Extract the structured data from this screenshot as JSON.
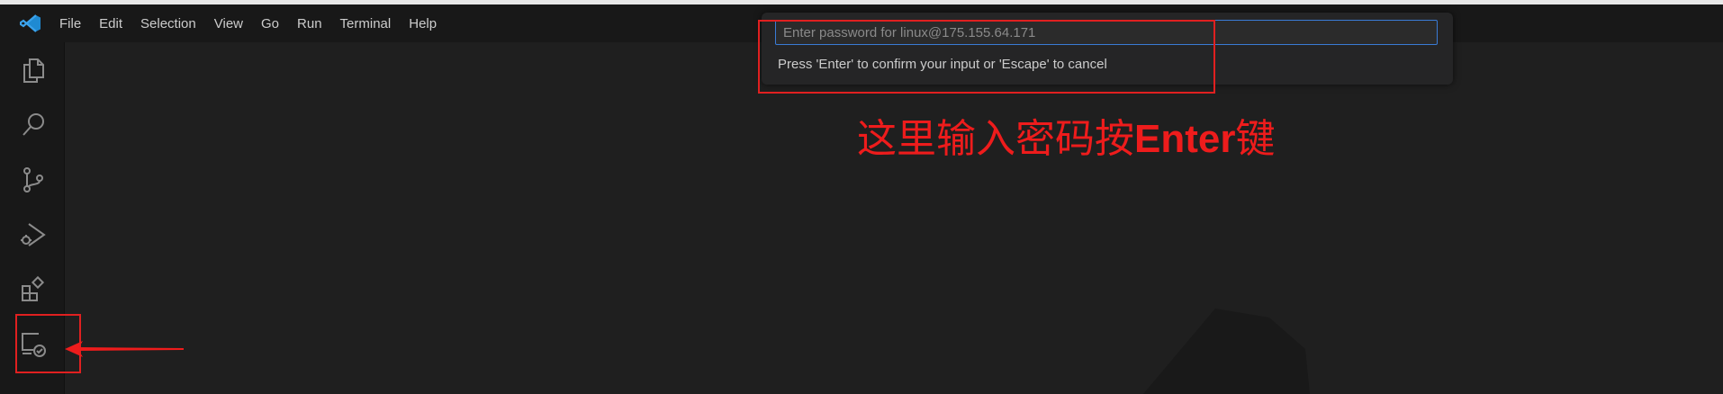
{
  "menu": {
    "items": [
      "File",
      "Edit",
      "Selection",
      "View",
      "Go",
      "Run",
      "Terminal",
      "Help"
    ]
  },
  "activity_bar": {
    "icons": [
      "explorer-icon",
      "search-icon",
      "source-control-icon",
      "run-debug-icon",
      "extensions-icon",
      "remote-explorer-icon"
    ]
  },
  "quick_input": {
    "placeholder": "Enter password for linux@175.155.64.171",
    "value": "",
    "message": "Press 'Enter' to confirm your input or 'Escape' to cancel"
  },
  "annotation": {
    "prefix": "这里输入密码按",
    "bold": "Enter",
    "suffix": "键"
  },
  "colors": {
    "annotation": "#ee1c1c",
    "accent": "#3a7bd5",
    "background": "#1e1e1e"
  }
}
